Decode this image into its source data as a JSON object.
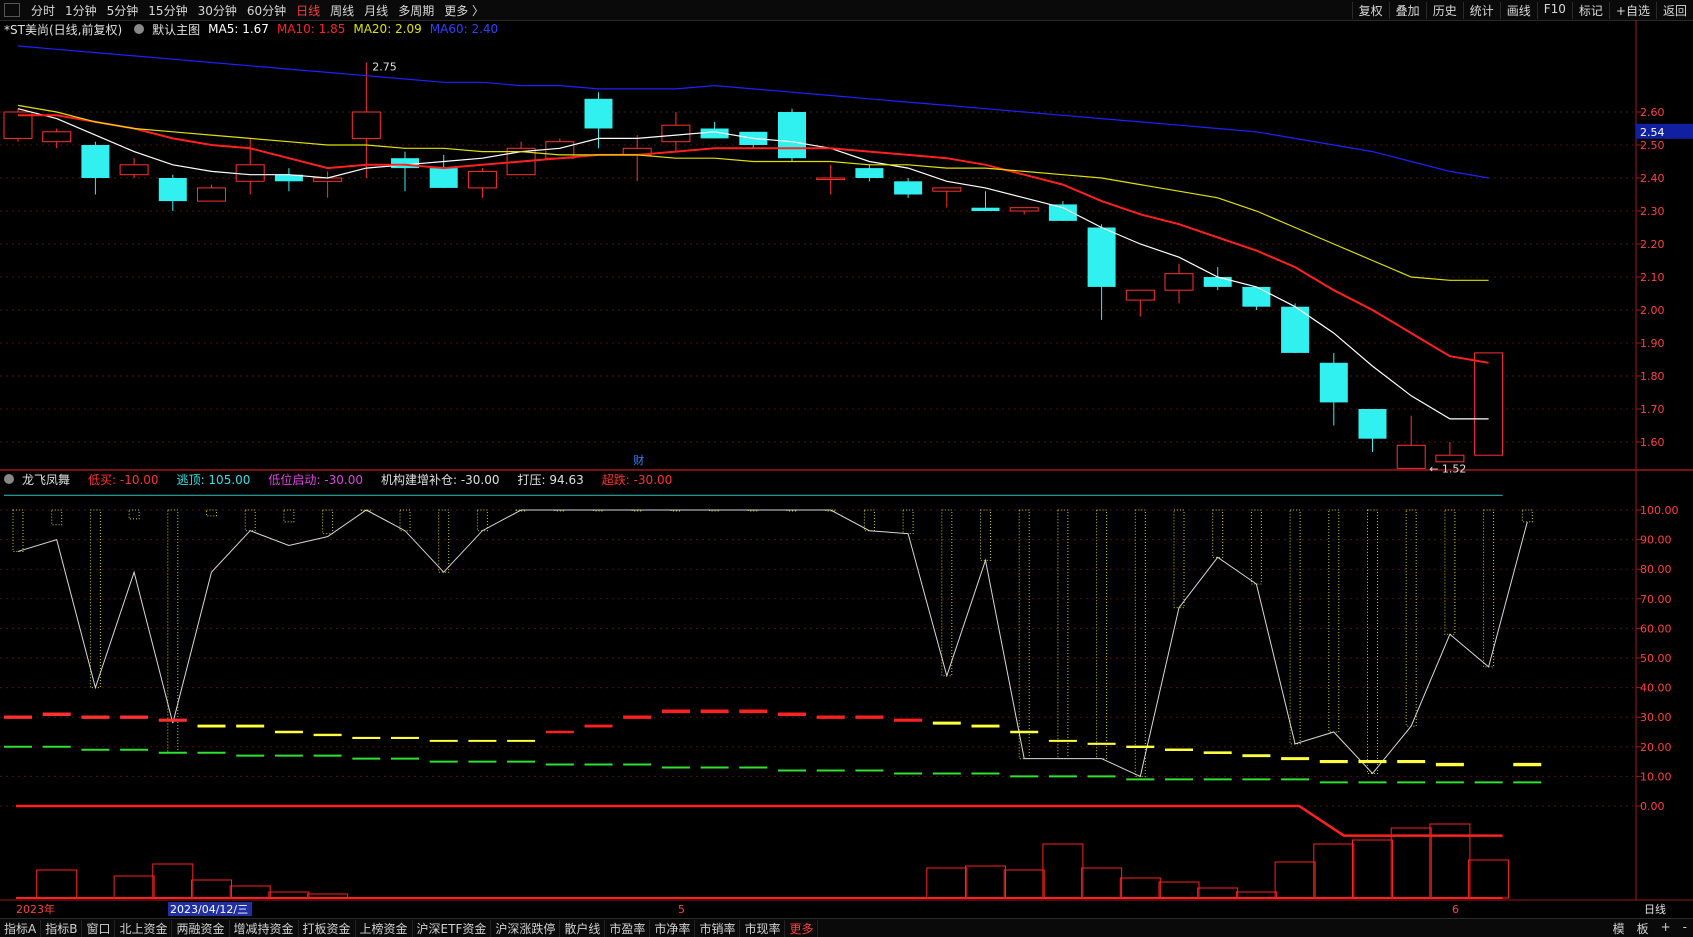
{
  "topbar": {
    "periods": [
      "分时",
      "1分钟",
      "5分钟",
      "15分钟",
      "30分钟",
      "60分钟",
      "日线",
      "周线",
      "月线",
      "多周期",
      "更多 〉"
    ],
    "active_period": "日线",
    "tools": [
      "复权",
      "叠加",
      "历史",
      "统计",
      "画线",
      "F10",
      "标记",
      "+自选",
      "返回"
    ]
  },
  "main_header": {
    "stock": "*ST美尚(日线,前复权)",
    "template": "默认主图",
    "ma5": "MA5: 1.67",
    "ma10": "MA10: 1.85",
    "ma20": "MA20: 2.09",
    "ma60": "MA60: 2.40"
  },
  "indicator_header": {
    "name": "龙飞凤舞",
    "items": [
      {
        "text": "低买: -10.00",
        "color": "#ff3030"
      },
      {
        "text": "逃顶: 105.00",
        "color": "#30e0e0"
      },
      {
        "text": "低位启动: -30.00",
        "color": "#e040e0"
      },
      {
        "text": "机构建增补仓: -30.00",
        "color": "#e0e0e0"
      },
      {
        "text": "打压: 94.63",
        "color": "#e0e0e0"
      },
      {
        "text": "超跌: -30.00",
        "color": "#ff3030"
      }
    ]
  },
  "annotations": {
    "high": "2.75",
    "low": "1.52",
    "fin_marker": "财",
    "current_price": "2.54"
  },
  "main_axis_ticks": [
    "2.60",
    "2.50",
    "2.40",
    "2.30",
    "2.20",
    "2.10",
    "2.00",
    "1.90",
    "1.80",
    "1.70",
    "1.60"
  ],
  "indicator_axis_ticks": [
    "100.00",
    "90.00",
    "80.00",
    "70.00",
    "60.00",
    "50.00",
    "40.00",
    "30.00",
    "20.00",
    "10.00",
    "0.00"
  ],
  "date_labels": {
    "start": "2023年",
    "cursor": "2023/04/12/三",
    "m5": "5",
    "m6": "6"
  },
  "period_label": "日线",
  "bottombar": {
    "tabs": [
      "指标A",
      "指标B",
      "窗口",
      "北上资金",
      "两融资金",
      "增减持资金",
      "打板资金",
      "上榜资金",
      "沪深ETF资金",
      "沪深涨跌停",
      "散户线",
      "市盈率",
      "市净率",
      "市销率",
      "市现率",
      "更多"
    ],
    "right": [
      "模",
      "板",
      "+",
      "-"
    ]
  },
  "chart_data": {
    "type": "candlestick",
    "ylim": [
      1.5,
      2.8
    ],
    "candles": [
      {
        "o": 2.52,
        "h": 2.61,
        "l": 2.51,
        "c": 2.6
      },
      {
        "o": 2.51,
        "h": 2.55,
        "l": 2.49,
        "c": 2.54
      },
      {
        "o": 2.5,
        "h": 2.51,
        "l": 2.35,
        "c": 2.4
      },
      {
        "o": 2.41,
        "h": 2.46,
        "l": 2.4,
        "c": 2.44
      },
      {
        "o": 2.4,
        "h": 2.41,
        "l": 2.3,
        "c": 2.33
      },
      {
        "o": 2.33,
        "h": 2.38,
        "l": 2.33,
        "c": 2.37
      },
      {
        "o": 2.39,
        "h": 2.52,
        "l": 2.35,
        "c": 2.44
      },
      {
        "o": 2.41,
        "h": 2.43,
        "l": 2.36,
        "c": 2.39
      },
      {
        "o": 2.39,
        "h": 2.42,
        "l": 2.34,
        "c": 2.4
      },
      {
        "o": 2.52,
        "h": 2.75,
        "l": 2.4,
        "c": 2.6
      },
      {
        "o": 2.46,
        "h": 2.48,
        "l": 2.36,
        "c": 2.43
      },
      {
        "o": 2.43,
        "h": 2.47,
        "l": 2.37,
        "c": 2.37
      },
      {
        "o": 2.37,
        "h": 2.43,
        "l": 2.34,
        "c": 2.42
      },
      {
        "o": 2.41,
        "h": 2.51,
        "l": 2.41,
        "c": 2.49
      },
      {
        "o": 2.46,
        "h": 2.52,
        "l": 2.46,
        "c": 2.51
      },
      {
        "o": 2.64,
        "h": 2.66,
        "l": 2.49,
        "c": 2.55
      },
      {
        "o": 2.47,
        "h": 2.53,
        "l": 2.39,
        "c": 2.49
      },
      {
        "o": 2.51,
        "h": 2.6,
        "l": 2.48,
        "c": 2.56
      },
      {
        "o": 2.55,
        "h": 2.57,
        "l": 2.52,
        "c": 2.52
      },
      {
        "o": 2.54,
        "h": 2.54,
        "l": 2.49,
        "c": 2.5
      },
      {
        "o": 2.6,
        "h": 2.61,
        "l": 2.45,
        "c": 2.46
      },
      {
        "o": 2.4,
        "h": 2.44,
        "l": 2.35,
        "c": 2.4
      },
      {
        "o": 2.43,
        "h": 2.44,
        "l": 2.39,
        "c": 2.4
      },
      {
        "o": 2.39,
        "h": 2.4,
        "l": 2.34,
        "c": 2.35
      },
      {
        "o": 2.36,
        "h": 2.37,
        "l": 2.31,
        "c": 2.37
      },
      {
        "o": 2.31,
        "h": 2.36,
        "l": 2.3,
        "c": 2.3
      },
      {
        "o": 2.3,
        "h": 2.31,
        "l": 2.29,
        "c": 2.31
      },
      {
        "o": 2.32,
        "h": 2.33,
        "l": 2.27,
        "c": 2.27
      },
      {
        "o": 2.25,
        "h": 2.26,
        "l": 1.97,
        "c": 2.07
      },
      {
        "o": 2.03,
        "h": 2.06,
        "l": 1.98,
        "c": 2.06
      },
      {
        "o": 2.06,
        "h": 2.14,
        "l": 2.02,
        "c": 2.11
      },
      {
        "o": 2.1,
        "h": 2.13,
        "l": 2.06,
        "c": 2.07
      },
      {
        "o": 2.07,
        "h": 2.07,
        "l": 2.0,
        "c": 2.01
      },
      {
        "o": 2.01,
        "h": 2.02,
        "l": 1.87,
        "c": 1.87
      },
      {
        "o": 1.84,
        "h": 1.87,
        "l": 1.65,
        "c": 1.72
      },
      {
        "o": 1.7,
        "h": 1.7,
        "l": 1.57,
        "c": 1.61
      },
      {
        "o": 1.52,
        "h": 1.68,
        "l": 1.52,
        "c": 1.59
      },
      {
        "o": 1.54,
        "h": 1.6,
        "l": 1.54,
        "c": 1.56
      },
      {
        "o": 1.56,
        "h": 1.87,
        "l": 1.56,
        "c": 1.87
      }
    ],
    "ma": [
      {
        "name": "MA5",
        "color": "#ffffff",
        "values": [
          2.61,
          2.58,
          2.53,
          2.48,
          2.44,
          2.42,
          2.41,
          2.41,
          2.4,
          2.43,
          2.44,
          2.45,
          2.46,
          2.48,
          2.49,
          2.52,
          2.52,
          2.53,
          2.54,
          2.52,
          2.51,
          2.49,
          2.45,
          2.43,
          2.39,
          2.37,
          2.34,
          2.31,
          2.25,
          2.2,
          2.16,
          2.1,
          2.07,
          2.01,
          1.93,
          1.83,
          1.74,
          1.67,
          1.67
        ]
      },
      {
        "name": "MA10",
        "color": "#ff2020",
        "values": [
          2.59,
          2.59,
          2.57,
          2.55,
          2.52,
          2.5,
          2.49,
          2.46,
          2.43,
          2.44,
          2.44,
          2.43,
          2.44,
          2.45,
          2.46,
          2.47,
          2.47,
          2.48,
          2.49,
          2.49,
          2.49,
          2.49,
          2.48,
          2.47,
          2.46,
          2.44,
          2.41,
          2.38,
          2.33,
          2.29,
          2.26,
          2.22,
          2.18,
          2.13,
          2.06,
          2.0,
          1.93,
          1.86,
          1.84
        ]
      },
      {
        "name": "MA20",
        "color": "#e0e000",
        "values": [
          2.62,
          2.6,
          2.57,
          2.55,
          2.54,
          2.53,
          2.52,
          2.51,
          2.5,
          2.5,
          2.49,
          2.49,
          2.48,
          2.48,
          2.47,
          2.47,
          2.47,
          2.46,
          2.46,
          2.45,
          2.45,
          2.45,
          2.44,
          2.44,
          2.43,
          2.43,
          2.42,
          2.41,
          2.4,
          2.38,
          2.36,
          2.34,
          2.3,
          2.25,
          2.2,
          2.15,
          2.1,
          2.09,
          2.09
        ]
      },
      {
        "name": "MA60",
        "color": "#2020ff",
        "values": [
          2.8,
          2.79,
          2.78,
          2.77,
          2.76,
          2.75,
          2.74,
          2.73,
          2.72,
          2.71,
          2.7,
          2.69,
          2.69,
          2.68,
          2.68,
          2.67,
          2.67,
          2.67,
          2.68,
          2.67,
          2.66,
          2.65,
          2.64,
          2.63,
          2.62,
          2.61,
          2.6,
          2.59,
          2.58,
          2.57,
          2.56,
          2.55,
          2.54,
          2.52,
          2.5,
          2.48,
          2.45,
          2.42,
          2.4
        ]
      }
    ],
    "indicator": {
      "ylim": [
        0,
        110
      ],
      "bars": [
        86,
        95,
        40,
        97,
        18,
        98,
        93,
        96,
        92,
        100,
        93,
        79,
        93,
        100,
        100,
        100,
        100,
        100,
        100,
        100,
        100,
        100,
        93,
        92,
        44,
        83,
        16,
        16,
        16,
        10,
        67,
        84,
        75,
        21,
        25,
        11,
        27,
        58,
        47,
        96
      ],
      "line": [
        86,
        90,
        40,
        79,
        28,
        79,
        93,
        88,
        91,
        100,
        93,
        79,
        93,
        100,
        100,
        100,
        100,
        100,
        100,
        100,
        100,
        100,
        93,
        92,
        44,
        83,
        16,
        16,
        16,
        10,
        67,
        84,
        75,
        21,
        25,
        11,
        27,
        58,
        47,
        96
      ],
      "upper_dashed": [
        30,
        31,
        30,
        30,
        29,
        27,
        27,
        25,
        24,
        23,
        23,
        22,
        22,
        22,
        25,
        27,
        30,
        32,
        32,
        32,
        31,
        30,
        30,
        29,
        28,
        27,
        25,
        22,
        21,
        20,
        19,
        18,
        17,
        16,
        15,
        15,
        15,
        14,
        14,
        14
      ],
      "lower_dashed": [
        20,
        20,
        19,
        19,
        18,
        18,
        17,
        17,
        17,
        16,
        16,
        15,
        15,
        15,
        14,
        14,
        14,
        13,
        13,
        13,
        12,
        12,
        12,
        11,
        11,
        11,
        10,
        10,
        10,
        9,
        9,
        9,
        9,
        9,
        8,
        8,
        8,
        8,
        8,
        8
      ]
    }
  }
}
